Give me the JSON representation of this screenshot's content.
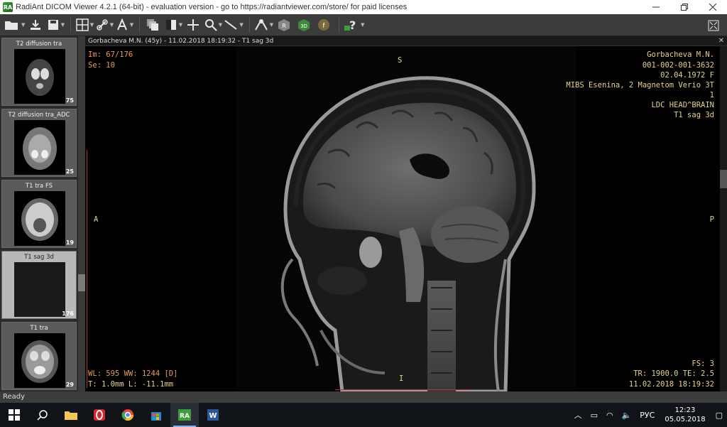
{
  "window": {
    "title": "RadiAnt DICOM Viewer 4.2.1 (64-bit) - evaluation version - go to https://radiantviewer.com/store/ for paid licenses",
    "app_icon": "RA"
  },
  "thumbnails": [
    {
      "label": "T2 diffusion tra",
      "count": "75"
    },
    {
      "label": "T2 diffusion tra_ADC",
      "count": "25"
    },
    {
      "label": "T1 tra FS",
      "count": "19"
    },
    {
      "label": "T1 sag 3d",
      "count": "176"
    },
    {
      "label": "T1 tra",
      "count": "29"
    }
  ],
  "viewer": {
    "header": "Gorbacheva M.N. (45y) - 11.02.2018 18:19:32 - T1 sag 3d",
    "image_number": "Im: 67/176",
    "series": "Se: 10",
    "patient_name": "Gorbacheva M.N.",
    "patient_id": "001-002-001-3632",
    "birth_sex": "02.04.1972 F",
    "institution": "MIBS Esenina, 2 Magnetom Verio 3T",
    "acq_number": "1",
    "study": "LDC HEAD^BRAIN",
    "series_name": "T1 sag 3d",
    "orient_top": "S",
    "orient_bottom": "I",
    "orient_left": "A",
    "orient_right": "P",
    "window_level": "WL: 595 WW: 1244 [D]",
    "thickness_location": "T: 1.0mm L: -11.1mm",
    "field_strength": "FS: 3",
    "tr_te": "TR: 1900.0 TE: 2.5",
    "acq_datetime": "11.02.2018 18:19:32"
  },
  "status": {
    "text": "Ready"
  },
  "taskbar": {
    "language": "РУС",
    "time": "12:23",
    "date": "05.05.2018"
  },
  "colors": {
    "overlay_orange": "#e0a04e",
    "overlay_yellow": "#e6d48a",
    "toolbar_bg": "#3c3c3c",
    "taskbar_bg": "#101418"
  }
}
